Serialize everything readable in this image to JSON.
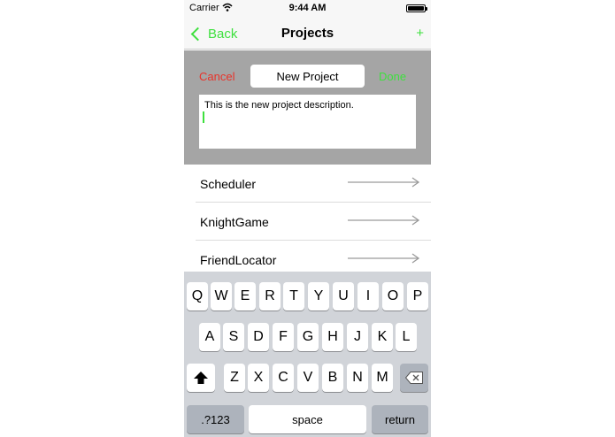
{
  "status_bar": {
    "carrier": "Carrier",
    "time": "9:44 AM"
  },
  "nav": {
    "back_label": "Back",
    "title": "Projects",
    "add_label": "+"
  },
  "edit": {
    "cancel_label": "Cancel",
    "name_value": "New Project",
    "done_label": "Done",
    "description_value": "This is the new project description."
  },
  "projects": [
    "Scheduler",
    "KnightGame",
    "FriendLocator"
  ],
  "keyboard": {
    "row1": [
      "Q",
      "W",
      "E",
      "R",
      "T",
      "Y",
      "U",
      "I",
      "O",
      "P"
    ],
    "row2": [
      "A",
      "S",
      "D",
      "F",
      "G",
      "H",
      "J",
      "K",
      "L"
    ],
    "row3": [
      "Z",
      "X",
      "C",
      "V",
      "B",
      "N",
      "M"
    ],
    "numbers_label": ".?123",
    "space_label": "space",
    "return_label": "return"
  },
  "colors": {
    "accent_green": "#3ee03e",
    "cancel_red": "#e8332a",
    "panel_gray": "#a5a5a5",
    "keyboard_bg": "#d1d4d9"
  }
}
